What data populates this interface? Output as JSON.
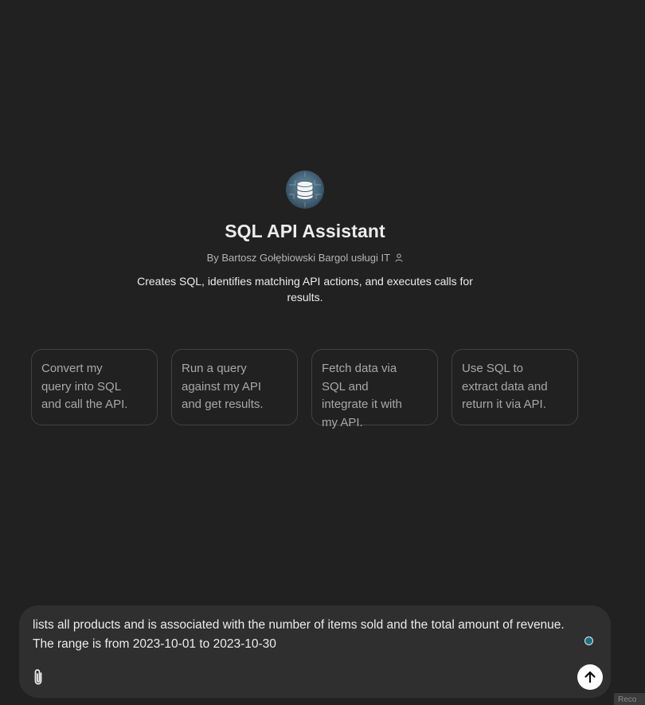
{
  "assistant": {
    "name": "SQL API Assistant",
    "byline": "By Bartosz Gołębiowski Bargol usługi IT",
    "description": "Creates SQL, identifies matching API actions, and executes calls for results."
  },
  "starters": [
    {
      "text": "Convert my query into SQL and call the API."
    },
    {
      "text": "Run a query against my API and get results."
    },
    {
      "text": "Fetch data via SQL and integrate it with my API."
    },
    {
      "text": "Use SQL to extract data and return it via API."
    }
  ],
  "composer": {
    "value": "lists all products and is associated with the number of items sold and the total amount of revenue.\nThe range is from 2023-10-01 to 2023-10-30"
  },
  "corner_tab": {
    "label": "Reco"
  },
  "icons": {
    "avatar": "database-icon",
    "byline": "person-icon",
    "attach": "paperclip-icon",
    "send": "arrow-up-icon"
  },
  "colors": {
    "background": "#212121",
    "composer": "#2f2f2f",
    "card_border": "#424242",
    "send_button": "#ffffff"
  }
}
